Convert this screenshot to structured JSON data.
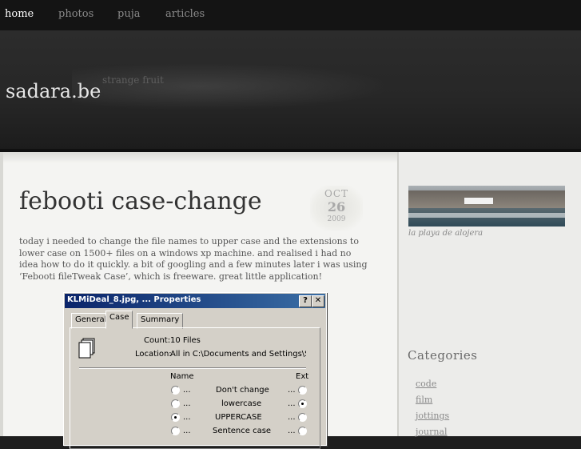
{
  "nav": {
    "items": [
      "home",
      "photos",
      "puja",
      "articles"
    ],
    "active": "home"
  },
  "header": {
    "site_title": "sadara.be",
    "tagline": "strange fruit"
  },
  "post": {
    "title": "febooti case-change",
    "date": {
      "month": "OCT",
      "day": "26",
      "year": "2009"
    },
    "body": "today i needed to change the file names to upper case and the extensions to lower case on 1500+ files on a windows xp machine. and realised i had no idea how to do it quickly. a bit of googling and a few minutes later i was using ‘Febooti fileTweak Case’, which is freeware. great little application!"
  },
  "dialog": {
    "title": "KLMiDeal_8.jpg, ... Properties",
    "help_button": "?",
    "close_button": "✕",
    "tabs": [
      "General",
      "Case",
      "Summary"
    ],
    "active_tab": "Case",
    "count_label": "Count:",
    "count_value": "10 Files",
    "location_label": "Location:",
    "location_value": "All in C:\\Documents and Settings\\Sadar",
    "name_header": "Name",
    "ext_header": "Ext",
    "ellipsis": "...",
    "options": [
      "Don't change",
      "lowercase",
      "UPPERCASE",
      "Sentence case"
    ],
    "name_selected": "UPPERCASE",
    "ext_selected": "lowercase"
  },
  "sidebar": {
    "photo_caption": "la playa de alojera",
    "categories_heading": "Categories",
    "categories": [
      "code",
      "film",
      "jottings",
      "journal"
    ]
  },
  "colors": {
    "nav_bg": "#141414",
    "header_bg": "#2a2a2a",
    "content_bg": "#f4f4f2",
    "text": "#555555",
    "title_bar": "#0a246a"
  }
}
